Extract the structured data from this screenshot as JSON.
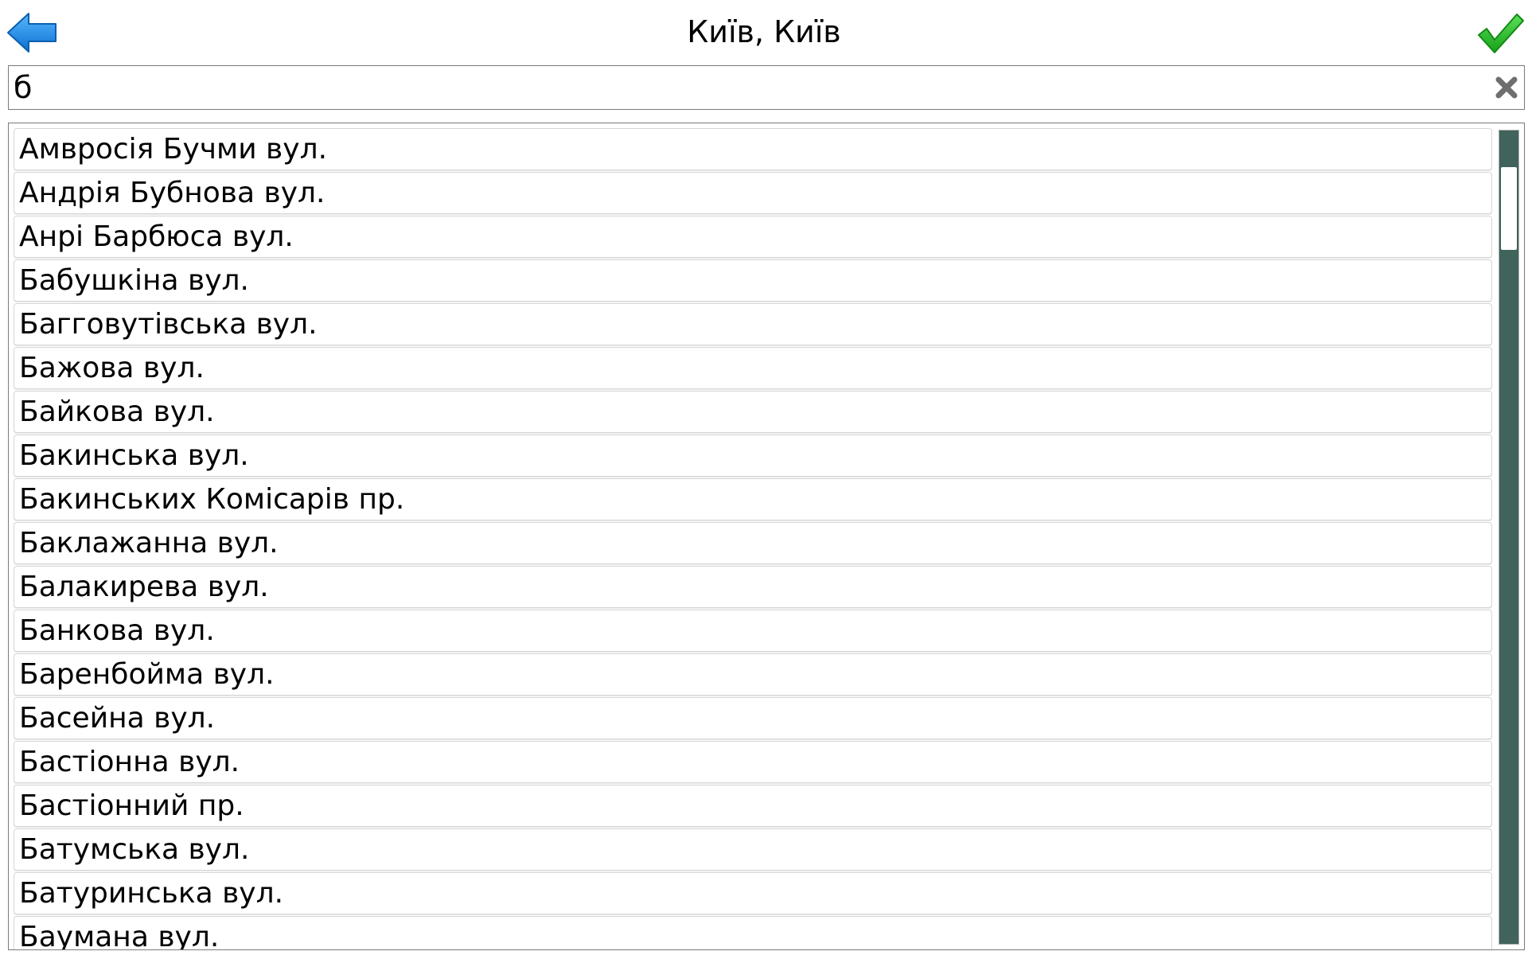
{
  "header": {
    "title": "Київ, Київ",
    "back_icon": "back-arrow-icon",
    "ok_icon": "checkmark-icon",
    "back_color": "#1e8fe8",
    "ok_color": "#2fc22f"
  },
  "search": {
    "value": "б",
    "clear_icon": "close-x-icon"
  },
  "streets": [
    "Амвросія Бучми вул.",
    "Андрія Бубнова вул.",
    "Анрі Барбюса вул.",
    "Бабушкіна вул.",
    "Багговутівська вул.",
    "Бажова вул.",
    "Байкова вул.",
    "Бакинська вул.",
    "Бакинських Комісарів пр.",
    "Баклажанна вул.",
    "Балакирева вул.",
    "Банкова вул.",
    "Баренбойма вул.",
    "Басейна вул.",
    "Бастіонна вул.",
    "Бастіонний пр.",
    "Батумська вул.",
    "Батуринська вул.",
    "Баумана вул."
  ],
  "scrollbar": {
    "track_color": "#40635c",
    "position": 0.04
  }
}
